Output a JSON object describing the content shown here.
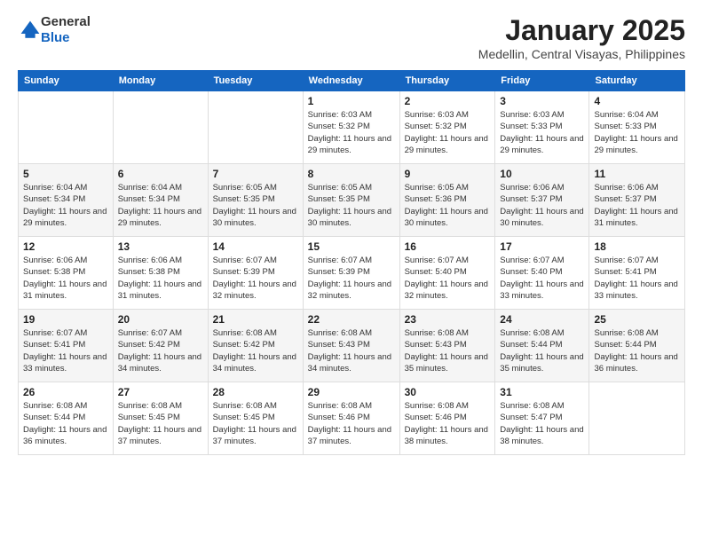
{
  "header": {
    "logo": {
      "general": "General",
      "blue": "Blue"
    },
    "title": "January 2025",
    "subtitle": "Medellin, Central Visayas, Philippines"
  },
  "weekdays": [
    "Sunday",
    "Monday",
    "Tuesday",
    "Wednesday",
    "Thursday",
    "Friday",
    "Saturday"
  ],
  "weeks": [
    [
      {
        "day": "",
        "sunrise": "",
        "sunset": "",
        "daylight": ""
      },
      {
        "day": "",
        "sunrise": "",
        "sunset": "",
        "daylight": ""
      },
      {
        "day": "",
        "sunrise": "",
        "sunset": "",
        "daylight": ""
      },
      {
        "day": "1",
        "sunrise": "Sunrise: 6:03 AM",
        "sunset": "Sunset: 5:32 PM",
        "daylight": "Daylight: 11 hours and 29 minutes."
      },
      {
        "day": "2",
        "sunrise": "Sunrise: 6:03 AM",
        "sunset": "Sunset: 5:32 PM",
        "daylight": "Daylight: 11 hours and 29 minutes."
      },
      {
        "day": "3",
        "sunrise": "Sunrise: 6:03 AM",
        "sunset": "Sunset: 5:33 PM",
        "daylight": "Daylight: 11 hours and 29 minutes."
      },
      {
        "day": "4",
        "sunrise": "Sunrise: 6:04 AM",
        "sunset": "Sunset: 5:33 PM",
        "daylight": "Daylight: 11 hours and 29 minutes."
      }
    ],
    [
      {
        "day": "5",
        "sunrise": "Sunrise: 6:04 AM",
        "sunset": "Sunset: 5:34 PM",
        "daylight": "Daylight: 11 hours and 29 minutes."
      },
      {
        "day": "6",
        "sunrise": "Sunrise: 6:04 AM",
        "sunset": "Sunset: 5:34 PM",
        "daylight": "Daylight: 11 hours and 29 minutes."
      },
      {
        "day": "7",
        "sunrise": "Sunrise: 6:05 AM",
        "sunset": "Sunset: 5:35 PM",
        "daylight": "Daylight: 11 hours and 30 minutes."
      },
      {
        "day": "8",
        "sunrise": "Sunrise: 6:05 AM",
        "sunset": "Sunset: 5:35 PM",
        "daylight": "Daylight: 11 hours and 30 minutes."
      },
      {
        "day": "9",
        "sunrise": "Sunrise: 6:05 AM",
        "sunset": "Sunset: 5:36 PM",
        "daylight": "Daylight: 11 hours and 30 minutes."
      },
      {
        "day": "10",
        "sunrise": "Sunrise: 6:06 AM",
        "sunset": "Sunset: 5:37 PM",
        "daylight": "Daylight: 11 hours and 30 minutes."
      },
      {
        "day": "11",
        "sunrise": "Sunrise: 6:06 AM",
        "sunset": "Sunset: 5:37 PM",
        "daylight": "Daylight: 11 hours and 31 minutes."
      }
    ],
    [
      {
        "day": "12",
        "sunrise": "Sunrise: 6:06 AM",
        "sunset": "Sunset: 5:38 PM",
        "daylight": "Daylight: 11 hours and 31 minutes."
      },
      {
        "day": "13",
        "sunrise": "Sunrise: 6:06 AM",
        "sunset": "Sunset: 5:38 PM",
        "daylight": "Daylight: 11 hours and 31 minutes."
      },
      {
        "day": "14",
        "sunrise": "Sunrise: 6:07 AM",
        "sunset": "Sunset: 5:39 PM",
        "daylight": "Daylight: 11 hours and 32 minutes."
      },
      {
        "day": "15",
        "sunrise": "Sunrise: 6:07 AM",
        "sunset": "Sunset: 5:39 PM",
        "daylight": "Daylight: 11 hours and 32 minutes."
      },
      {
        "day": "16",
        "sunrise": "Sunrise: 6:07 AM",
        "sunset": "Sunset: 5:40 PM",
        "daylight": "Daylight: 11 hours and 32 minutes."
      },
      {
        "day": "17",
        "sunrise": "Sunrise: 6:07 AM",
        "sunset": "Sunset: 5:40 PM",
        "daylight": "Daylight: 11 hours and 33 minutes."
      },
      {
        "day": "18",
        "sunrise": "Sunrise: 6:07 AM",
        "sunset": "Sunset: 5:41 PM",
        "daylight": "Daylight: 11 hours and 33 minutes."
      }
    ],
    [
      {
        "day": "19",
        "sunrise": "Sunrise: 6:07 AM",
        "sunset": "Sunset: 5:41 PM",
        "daylight": "Daylight: 11 hours and 33 minutes."
      },
      {
        "day": "20",
        "sunrise": "Sunrise: 6:07 AM",
        "sunset": "Sunset: 5:42 PM",
        "daylight": "Daylight: 11 hours and 34 minutes."
      },
      {
        "day": "21",
        "sunrise": "Sunrise: 6:08 AM",
        "sunset": "Sunset: 5:42 PM",
        "daylight": "Daylight: 11 hours and 34 minutes."
      },
      {
        "day": "22",
        "sunrise": "Sunrise: 6:08 AM",
        "sunset": "Sunset: 5:43 PM",
        "daylight": "Daylight: 11 hours and 34 minutes."
      },
      {
        "day": "23",
        "sunrise": "Sunrise: 6:08 AM",
        "sunset": "Sunset: 5:43 PM",
        "daylight": "Daylight: 11 hours and 35 minutes."
      },
      {
        "day": "24",
        "sunrise": "Sunrise: 6:08 AM",
        "sunset": "Sunset: 5:44 PM",
        "daylight": "Daylight: 11 hours and 35 minutes."
      },
      {
        "day": "25",
        "sunrise": "Sunrise: 6:08 AM",
        "sunset": "Sunset: 5:44 PM",
        "daylight": "Daylight: 11 hours and 36 minutes."
      }
    ],
    [
      {
        "day": "26",
        "sunrise": "Sunrise: 6:08 AM",
        "sunset": "Sunset: 5:44 PM",
        "daylight": "Daylight: 11 hours and 36 minutes."
      },
      {
        "day": "27",
        "sunrise": "Sunrise: 6:08 AM",
        "sunset": "Sunset: 5:45 PM",
        "daylight": "Daylight: 11 hours and 37 minutes."
      },
      {
        "day": "28",
        "sunrise": "Sunrise: 6:08 AM",
        "sunset": "Sunset: 5:45 PM",
        "daylight": "Daylight: 11 hours and 37 minutes."
      },
      {
        "day": "29",
        "sunrise": "Sunrise: 6:08 AM",
        "sunset": "Sunset: 5:46 PM",
        "daylight": "Daylight: 11 hours and 37 minutes."
      },
      {
        "day": "30",
        "sunrise": "Sunrise: 6:08 AM",
        "sunset": "Sunset: 5:46 PM",
        "daylight": "Daylight: 11 hours and 38 minutes."
      },
      {
        "day": "31",
        "sunrise": "Sunrise: 6:08 AM",
        "sunset": "Sunset: 5:47 PM",
        "daylight": "Daylight: 11 hours and 38 minutes."
      },
      {
        "day": "",
        "sunrise": "",
        "sunset": "",
        "daylight": ""
      }
    ]
  ]
}
